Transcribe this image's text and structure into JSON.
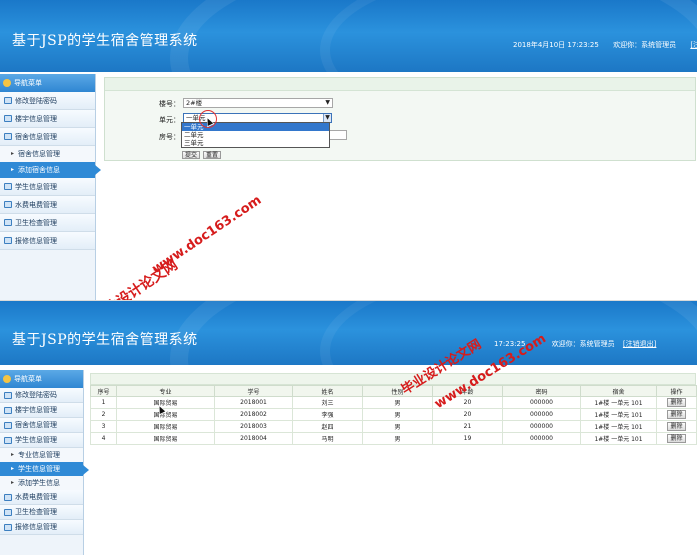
{
  "app": {
    "title": "基于JSP的学生宿舍管理系统",
    "datetime": "2018年4月10日 17:23:25",
    "time_only": "17:23:25",
    "welcome": "欢迎你：系统管理员",
    "logout": "[注销退出]",
    "logout_cut": "[注"
  },
  "sidebar": {
    "title": "导航菜单",
    "s1_items": [
      {
        "label": "修改登陆密码"
      },
      {
        "label": "楼宇信息管理"
      },
      {
        "label": "宿舍信息管理"
      },
      {
        "label": "宿舍信息管理"
      },
      {
        "label": "添加宿舍信息"
      },
      {
        "label": "学生信息管理"
      },
      {
        "label": "水费电费管理"
      },
      {
        "label": "卫生检查管理"
      },
      {
        "label": "报修信息管理"
      }
    ],
    "s2_items": [
      {
        "label": "修改登陆密码"
      },
      {
        "label": "楼宇信息管理"
      },
      {
        "label": "宿舍信息管理"
      },
      {
        "label": "学生信息管理"
      },
      {
        "label": "专业信息管理"
      },
      {
        "label": "学生信息管理"
      },
      {
        "label": "添加学生信息"
      },
      {
        "label": "水费电费管理"
      },
      {
        "label": "卫生检查管理"
      },
      {
        "label": "报修信息管理"
      }
    ]
  },
  "form": {
    "building_label": "楼号：",
    "building_value": "2#楼",
    "unit_label": "单元：",
    "unit_value": "一单元",
    "room_label": "房号：",
    "unit_options": [
      "一单元",
      "二单元",
      "三单元"
    ],
    "submit_cut": "提交",
    "reset_cut": "重置"
  },
  "table": {
    "headers": [
      "序号",
      "专业",
      "学号",
      "姓名",
      "性别",
      "年龄",
      "密码",
      "宿舍",
      "操作"
    ],
    "rows": [
      [
        "1",
        "国际贸易",
        "2018001",
        "刘三",
        "男",
        "20",
        "000000",
        "1#楼 一单元 101",
        "删除"
      ],
      [
        "2",
        "国际贸易",
        "2018002",
        "李强",
        "男",
        "20",
        "000000",
        "1#楼 一单元 101",
        "删除"
      ],
      [
        "3",
        "国际贸易",
        "2018003",
        "赵四",
        "男",
        "21",
        "000000",
        "1#楼 一单元 101",
        "删除"
      ],
      [
        "4",
        "国际贸易",
        "2018004",
        "马明",
        "男",
        "19",
        "000000",
        "1#楼 一单元 101",
        "删除"
      ]
    ]
  },
  "watermarks": {
    "cn": "毕业设计论文网",
    "url": "www.doc163.com"
  }
}
